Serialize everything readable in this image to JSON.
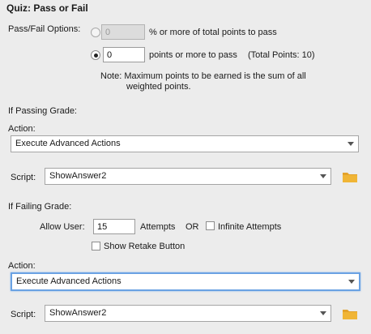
{
  "quiz": {
    "title": "Quiz: Pass or Fail",
    "pass_fail_options_label": "Pass/Fail Options:",
    "percent_option": {
      "value": "0",
      "suffix": "% or more of total points to pass",
      "selected": false
    },
    "points_option": {
      "value": "0",
      "suffix": "points or more to pass",
      "total_points": "(Total Points: 10)",
      "selected": true
    },
    "note_line1": "Note:  Maximum points to be earned is the sum of all",
    "note_line2": "weighted points."
  },
  "passing": {
    "header": "If Passing Grade:",
    "action_label": "Action:",
    "action_value": "Execute Advanced Actions",
    "script_label": "Script:",
    "script_value": "ShowAnswer2"
  },
  "failing": {
    "header": "If Failing Grade:",
    "allow_user_label": "Allow User:",
    "attempts_value": "15",
    "attempts_label": "Attempts",
    "or_label": "OR",
    "infinite_attempts_label": "Infinite Attempts",
    "infinite_attempts_checked": false,
    "show_retake_label": "Show Retake Button",
    "show_retake_checked": false,
    "action_label": "Action:",
    "action_value": "Execute Advanced Actions",
    "script_label": "Script:",
    "script_value": "ShowAnswer2"
  },
  "icons": {
    "folder": "folder-icon",
    "dropdown": "chevron-down-icon",
    "folder_color": "#e3a22a"
  }
}
